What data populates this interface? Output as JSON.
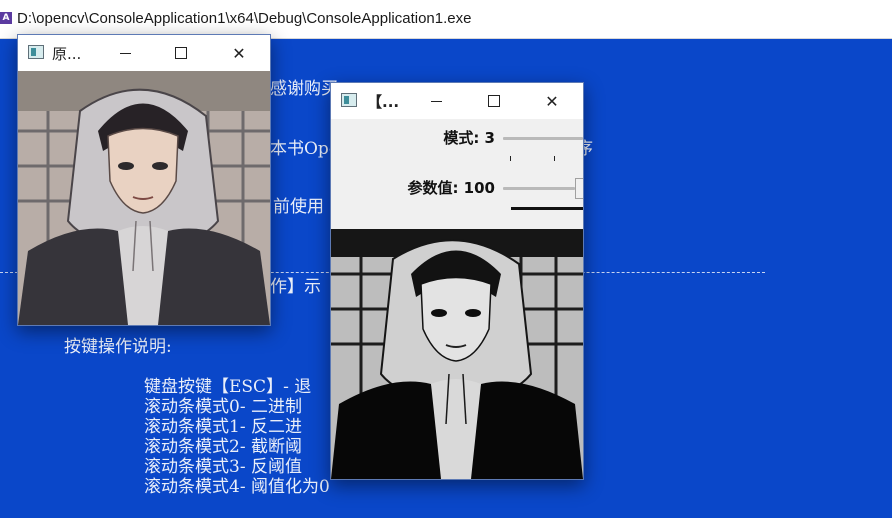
{
  "console": {
    "title": "D:\\opencv\\ConsoleApplication1\\x64\\Debug\\ConsoleApplication1.exe",
    "lines": {
      "thanks_fragment": "感谢购买",
      "book_fragment": "本书Ope",
      "version_fragment": "前使用",
      "demo_fragment": "作】示",
      "key_heading": "按键操作说明:",
      "key_esc": "键盘按键【ESC】- 退",
      "mode0": "滚动条模式0- 二进制",
      "mode1": "滚动条模式1- 反二进",
      "mode2": "滚动条模式2- 截断阈",
      "mode3": "滚动条模式3- 反阈值",
      "mode4": "滚动条模式4- 阈值化为0",
      "right_fragment_1": "序",
      "dashes": "-------------------"
    }
  },
  "original_window": {
    "title": "原...",
    "min_icon": "minimize-icon",
    "max_icon": "maximize-icon",
    "close_icon": "close-icon",
    "image": "portrait-color"
  },
  "result_window": {
    "title": "【...",
    "min_icon": "minimize-icon",
    "max_icon": "maximize-icon",
    "close_icon": "close-icon",
    "trackbars": [
      {
        "label": "模式: 3",
        "value": 3,
        "max": 4
      },
      {
        "label": "参数值: 100",
        "value": 100,
        "max": 255
      }
    ],
    "image": "portrait-threshold"
  }
}
